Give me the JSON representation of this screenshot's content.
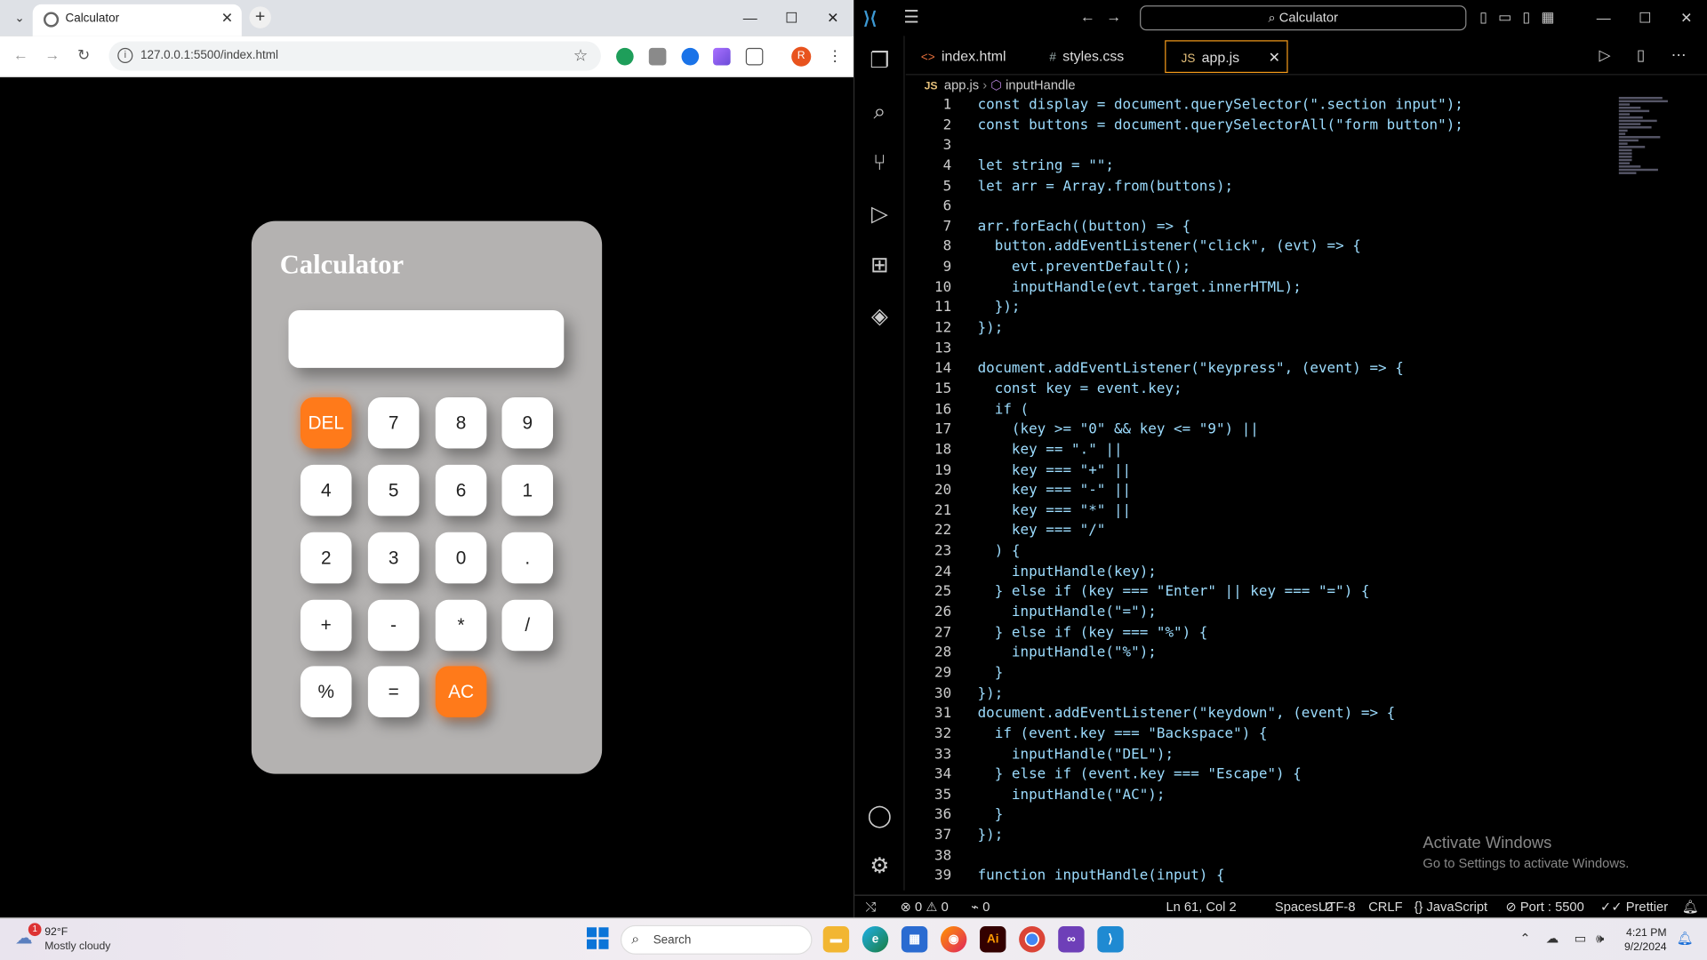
{
  "browser": {
    "tab_title": "Calculator",
    "url": "127.0.0.1:5500/index.html",
    "profile_initial": "R"
  },
  "calculator": {
    "title": "Calculator",
    "display_value": "",
    "keys": [
      {
        "label": "DEL",
        "accent": true
      },
      {
        "label": "7",
        "accent": false
      },
      {
        "label": "8",
        "accent": false
      },
      {
        "label": "9",
        "accent": false
      },
      {
        "label": "4",
        "accent": false
      },
      {
        "label": "5",
        "accent": false
      },
      {
        "label": "6",
        "accent": false
      },
      {
        "label": "1",
        "accent": false
      },
      {
        "label": "2",
        "accent": false
      },
      {
        "label": "3",
        "accent": false
      },
      {
        "label": "0",
        "accent": false
      },
      {
        "label": ".",
        "accent": false
      },
      {
        "label": "+",
        "accent": false
      },
      {
        "label": "-",
        "accent": false
      },
      {
        "label": "*",
        "accent": false
      },
      {
        "label": "/",
        "accent": false
      },
      {
        "label": "%",
        "accent": false
      },
      {
        "label": "=",
        "accent": false
      },
      {
        "label": "AC",
        "accent": true
      }
    ],
    "accent_color": "#ff7a1a",
    "body_color": "#b4b2b1"
  },
  "vscode": {
    "command_center": "Calculator",
    "tabs": [
      {
        "icon": "<>",
        "label": "index.html",
        "active": false
      },
      {
        "icon": "#",
        "label": "styles.css",
        "active": false
      },
      {
        "icon": "JS",
        "label": "app.js",
        "active": true
      }
    ],
    "breadcrumb": {
      "file": "app.js",
      "symbol": "inputHandle"
    },
    "code_lines": [
      "const display = document.querySelector(\".section input\");",
      "const buttons = document.querySelectorAll(\"form button\");",
      "",
      "let string = \"\";",
      "let arr = Array.from(buttons);",
      "",
      "arr.forEach((button) => {",
      "  button.addEventListener(\"click\", (evt) => {",
      "    evt.preventDefault();",
      "    inputHandle(evt.target.innerHTML);",
      "  });",
      "});",
      "",
      "document.addEventListener(\"keypress\", (event) => {",
      "  const key = event.key;",
      "  if (",
      "    (key >= \"0\" && key <= \"9\") ||",
      "    key == \".\" ||",
      "    key === \"+\" ||",
      "    key === \"-\" ||",
      "    key === \"*\" ||",
      "    key === \"/\"",
      "  ) {",
      "    inputHandle(key);",
      "  } else if (key === \"Enter\" || key === \"=\") {",
      "    inputHandle(\"=\");",
      "  } else if (key === \"%\") {",
      "    inputHandle(\"%\");",
      "  }",
      "});",
      "document.addEventListener(\"keydown\", (event) => {",
      "  if (event.key === \"Backspace\") {",
      "    inputHandle(\"DEL\");",
      "  } else if (event.key === \"Escape\") {",
      "    inputHandle(\"AC\");",
      "  }",
      "});",
      "",
      "function inputHandle(input) {"
    ],
    "watermark_title": "Activate Windows",
    "watermark_sub": "Go to Settings to activate Windows.",
    "status": {
      "errors": "0",
      "warnings": "0",
      "ports": "0",
      "position": "Ln 61, Col 2",
      "spaces": "Spaces: 2",
      "encoding": "UTF-8",
      "eol": "CRLF",
      "language": "JavaScript",
      "port": "Port : 5500",
      "formatter": "Prettier"
    }
  },
  "taskbar": {
    "weather_badge": "1",
    "temperature": "92°F",
    "condition": "Mostly cloudy",
    "search_placeholder": "Search",
    "time": "4:21 PM",
    "date": "9/2/2024"
  }
}
